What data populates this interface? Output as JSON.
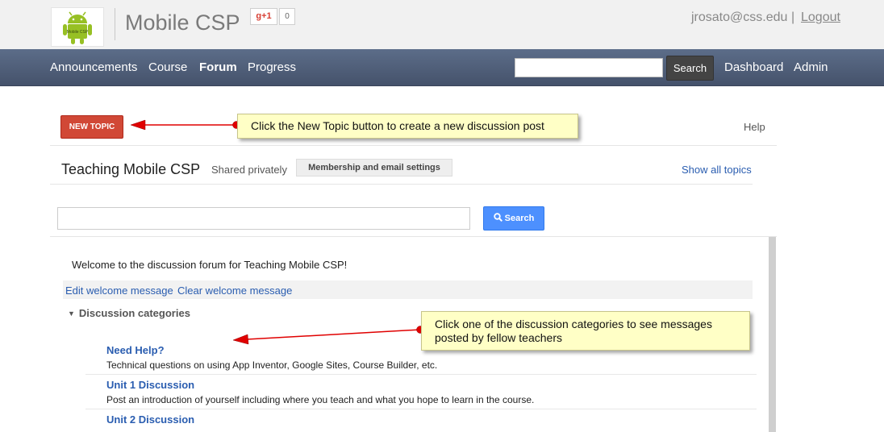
{
  "header": {
    "site_title": "Mobile CSP",
    "logo_text": "Mobile CSP",
    "gplus_label": "g+1",
    "gplus_count": "0",
    "user_email": "jrosato@css.edu",
    "separator": "|",
    "logout_label": "Logout"
  },
  "nav": {
    "items": [
      {
        "label": "Announcements"
      },
      {
        "label": "Course"
      },
      {
        "label": "Forum"
      },
      {
        "label": "Progress"
      }
    ],
    "search_button": "Search",
    "dashboard": "Dashboard",
    "admin": "Admin"
  },
  "forum": {
    "new_topic": "NEW TOPIC",
    "help": "Help",
    "title": "Teaching Mobile CSP",
    "shared": "Shared privately",
    "membership": "Membership and email settings",
    "show_all": "Show all topics",
    "search_button": "Search",
    "welcome": "Welcome to the discussion forum for Teaching Mobile CSP!",
    "edit_welcome": "Edit welcome message",
    "clear_welcome": "Clear welcome message",
    "categories_header": "Discussion categories",
    "categories": [
      {
        "name": "Need Help?",
        "desc": "Technical questions on using App Inventor, Google Sites, Course Builder, etc."
      },
      {
        "name": "Unit 1 Discussion",
        "desc": "Post an introduction of yourself including where you teach and what you hope to learn in the course."
      },
      {
        "name": "Unit 2 Discussion",
        "desc": ""
      }
    ]
  },
  "callouts": {
    "new_topic": "Click the New Topic button to create a new discussion post",
    "categories_line1": "Click one of the discussion categories to see messages",
    "categories_line2": "posted by fellow teachers"
  },
  "colors": {
    "nav_bg": "#4f5d78",
    "new_topic_red": "#d14836",
    "search_blue": "#4d90fe",
    "link_blue": "#2a5db0",
    "callout_yellow": "#ffffc6",
    "arrow_red": "#e00000"
  },
  "icons": {
    "logo": "android-robot-icon",
    "search": "magnifier-icon",
    "collapse": "triangle-down-icon"
  }
}
